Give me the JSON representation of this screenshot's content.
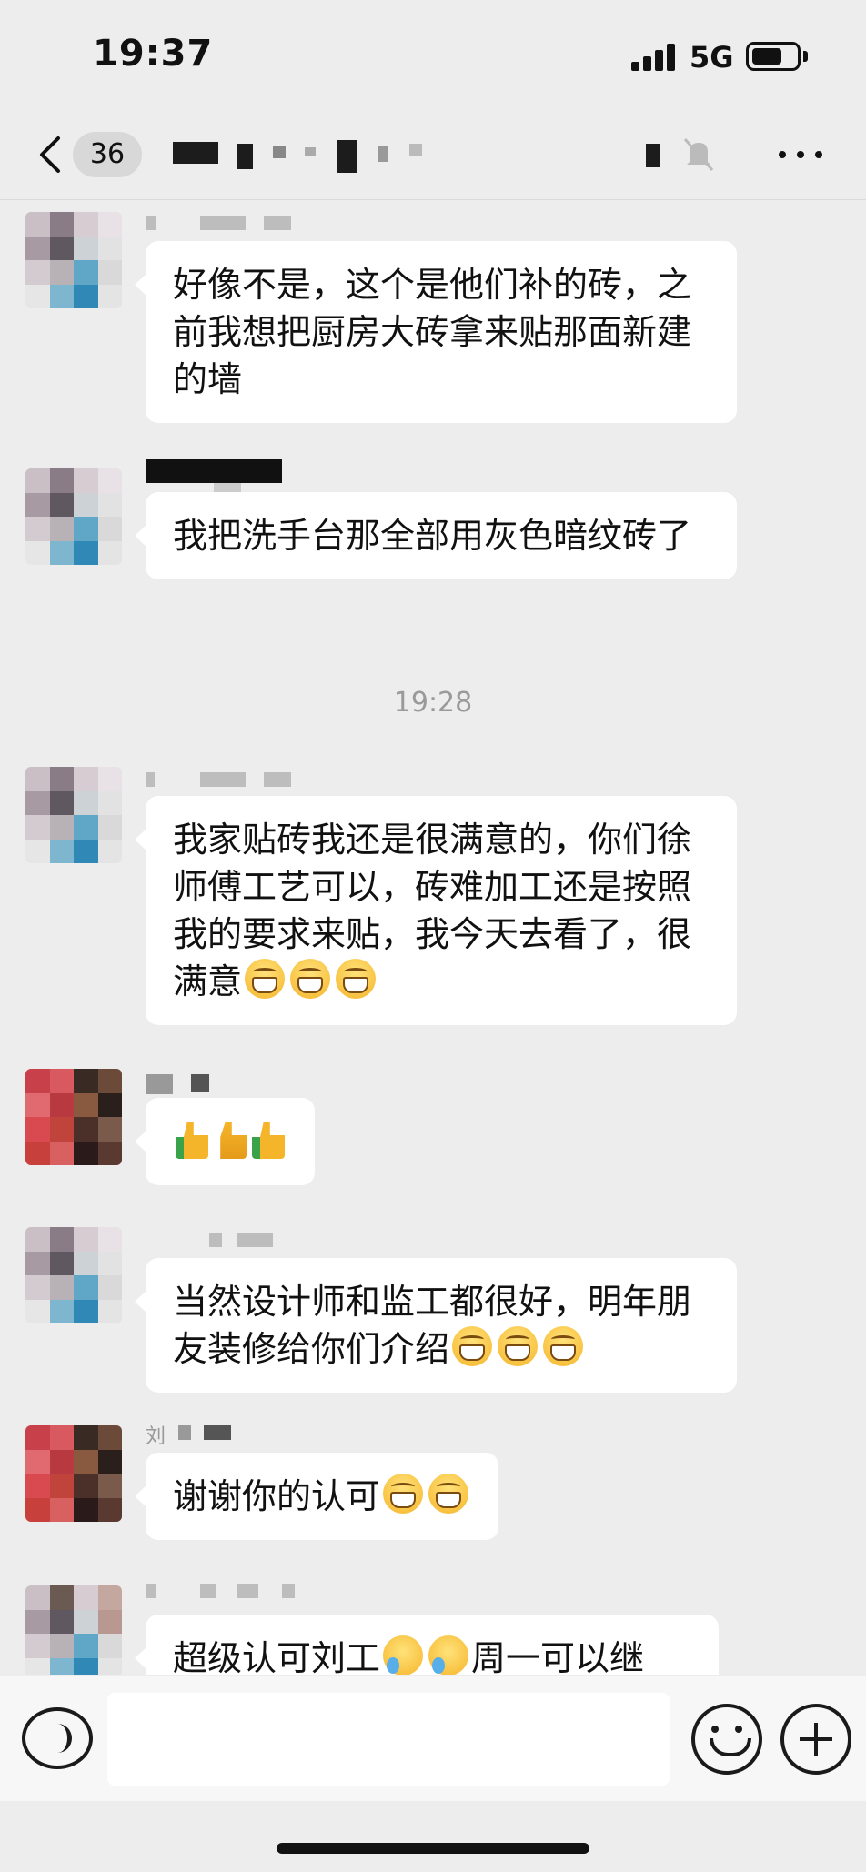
{
  "status_bar": {
    "time": "19:37",
    "network": "5G",
    "battery_level": 0.7
  },
  "nav": {
    "unread_count": "36",
    "back_icon": "chevron-left-icon",
    "mute_icon": "bell-off-icon",
    "more_icon": "more-horizontal-icon"
  },
  "messages": [
    {
      "text": "好像不是，这个是他们补的砖，之前我想把厨房大砖拿来贴那面新建的墙"
    },
    {
      "text": "我把洗手台那全部用灰色暗纹砖了"
    },
    {
      "timestamp": "19:28"
    },
    {
      "text": "我家贴砖我还是很满意的，你们徐师傅工艺可以，砖难加工还是按照我的要求来贴，我今天去看了，很满意"
    },
    {
      "text": ""
    },
    {
      "text": "当然设计师和监工都很好，明年朋友装修给你们介绍"
    },
    {
      "sender": "刘",
      "text": "谢谢你的认可"
    },
    {
      "text": "超级认可刘工",
      "text2": "周一可以继"
    }
  ],
  "input": {
    "placeholder": ""
  },
  "colors": {
    "background": "#ededed",
    "bubble": "#ffffff",
    "timestamp": "#9a9a9a"
  }
}
